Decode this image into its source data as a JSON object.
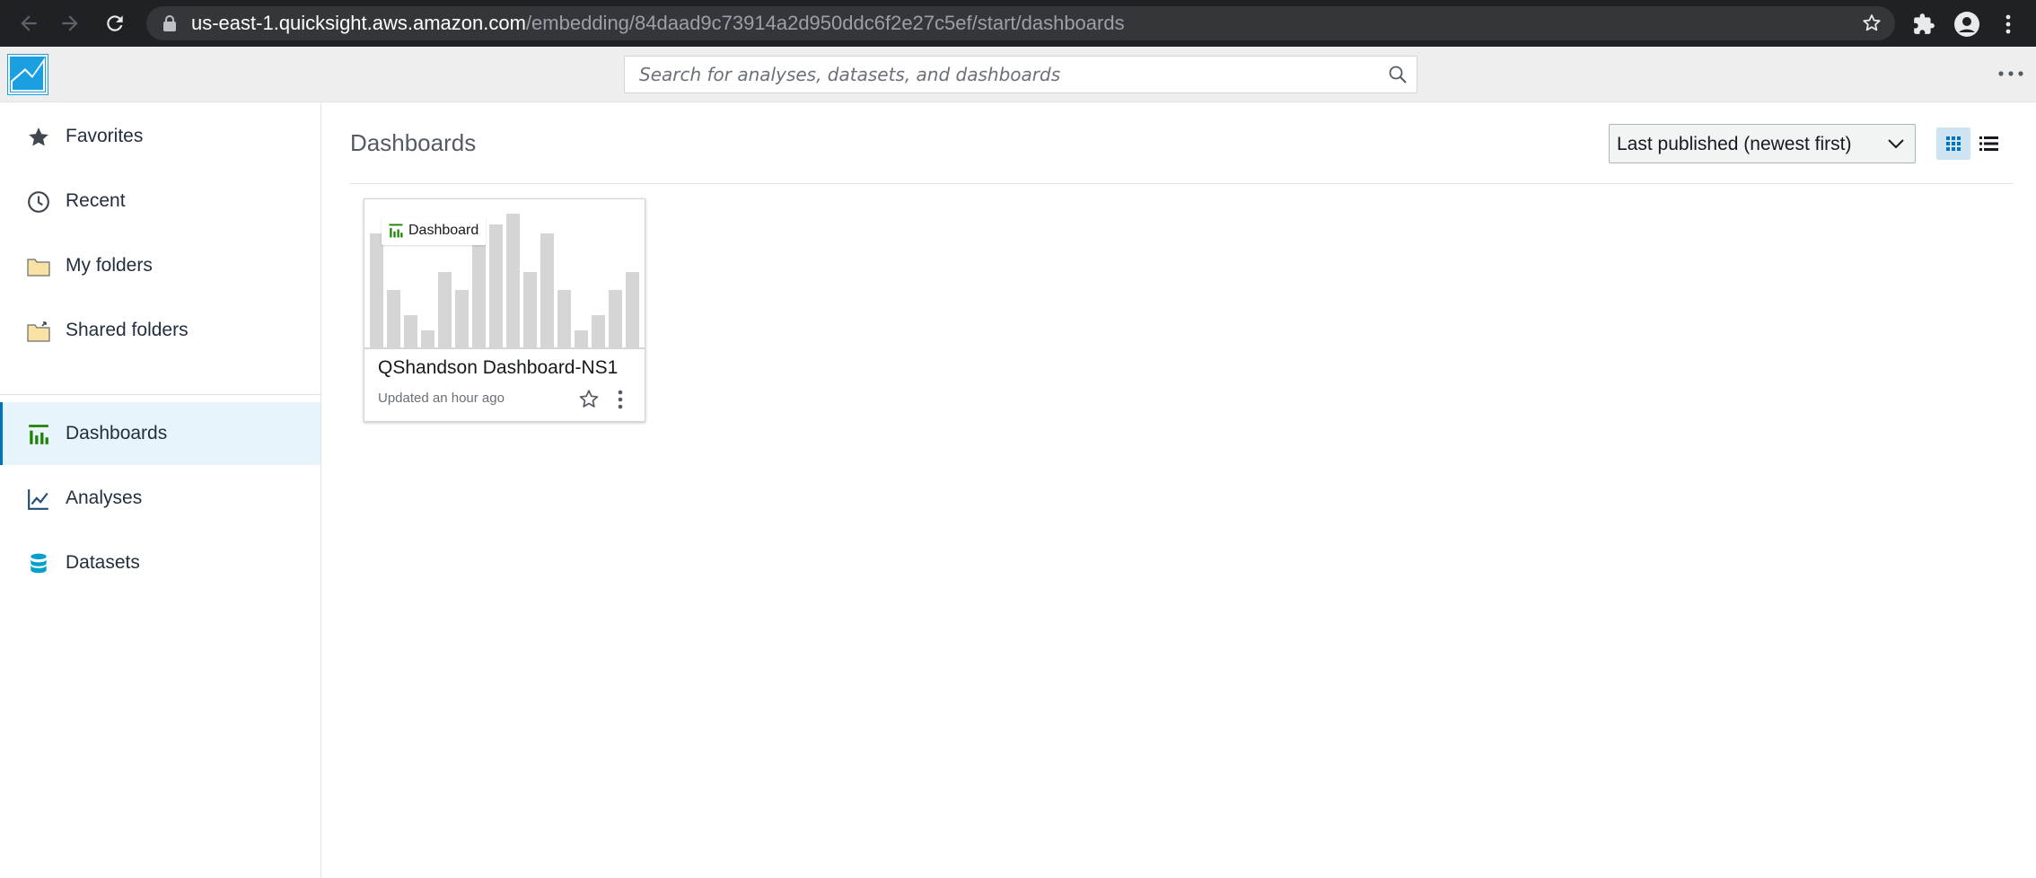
{
  "browser": {
    "url_host": "us-east-1.quicksight.aws.amazon.com",
    "url_path": "/embedding/84daad9c73914a2d950ddc6f2e27c5ef/start/dashboards"
  },
  "header": {
    "search_placeholder": "Search for analyses, datasets, and dashboards"
  },
  "sidebar": {
    "items": [
      {
        "label": "Favorites",
        "icon": "star-icon"
      },
      {
        "label": "Recent",
        "icon": "clock-icon"
      },
      {
        "label": "My folders",
        "icon": "folder-icon"
      },
      {
        "label": "Shared folders",
        "icon": "shared-folder-icon"
      },
      {
        "label": "Dashboards",
        "icon": "dashboard-icon",
        "active": true
      },
      {
        "label": "Analyses",
        "icon": "line-chart-icon"
      },
      {
        "label": "Datasets",
        "icon": "database-icon"
      }
    ]
  },
  "main": {
    "title": "Dashboards",
    "sort_selected": "Last published (newest first)",
    "view_mode": "grid",
    "cards": [
      {
        "badge": "Dashboard",
        "title": "QShandson Dashboard-NS1",
        "updated": "Updated an hour ago",
        "favorited": false
      }
    ]
  },
  "colors": {
    "accent": "#0073bb",
    "active_bg": "#e8f4fb",
    "dashboard_green": "#1d8102",
    "dataset_blue": "#00a1c9",
    "logo_blue": "#1a9fe0"
  }
}
